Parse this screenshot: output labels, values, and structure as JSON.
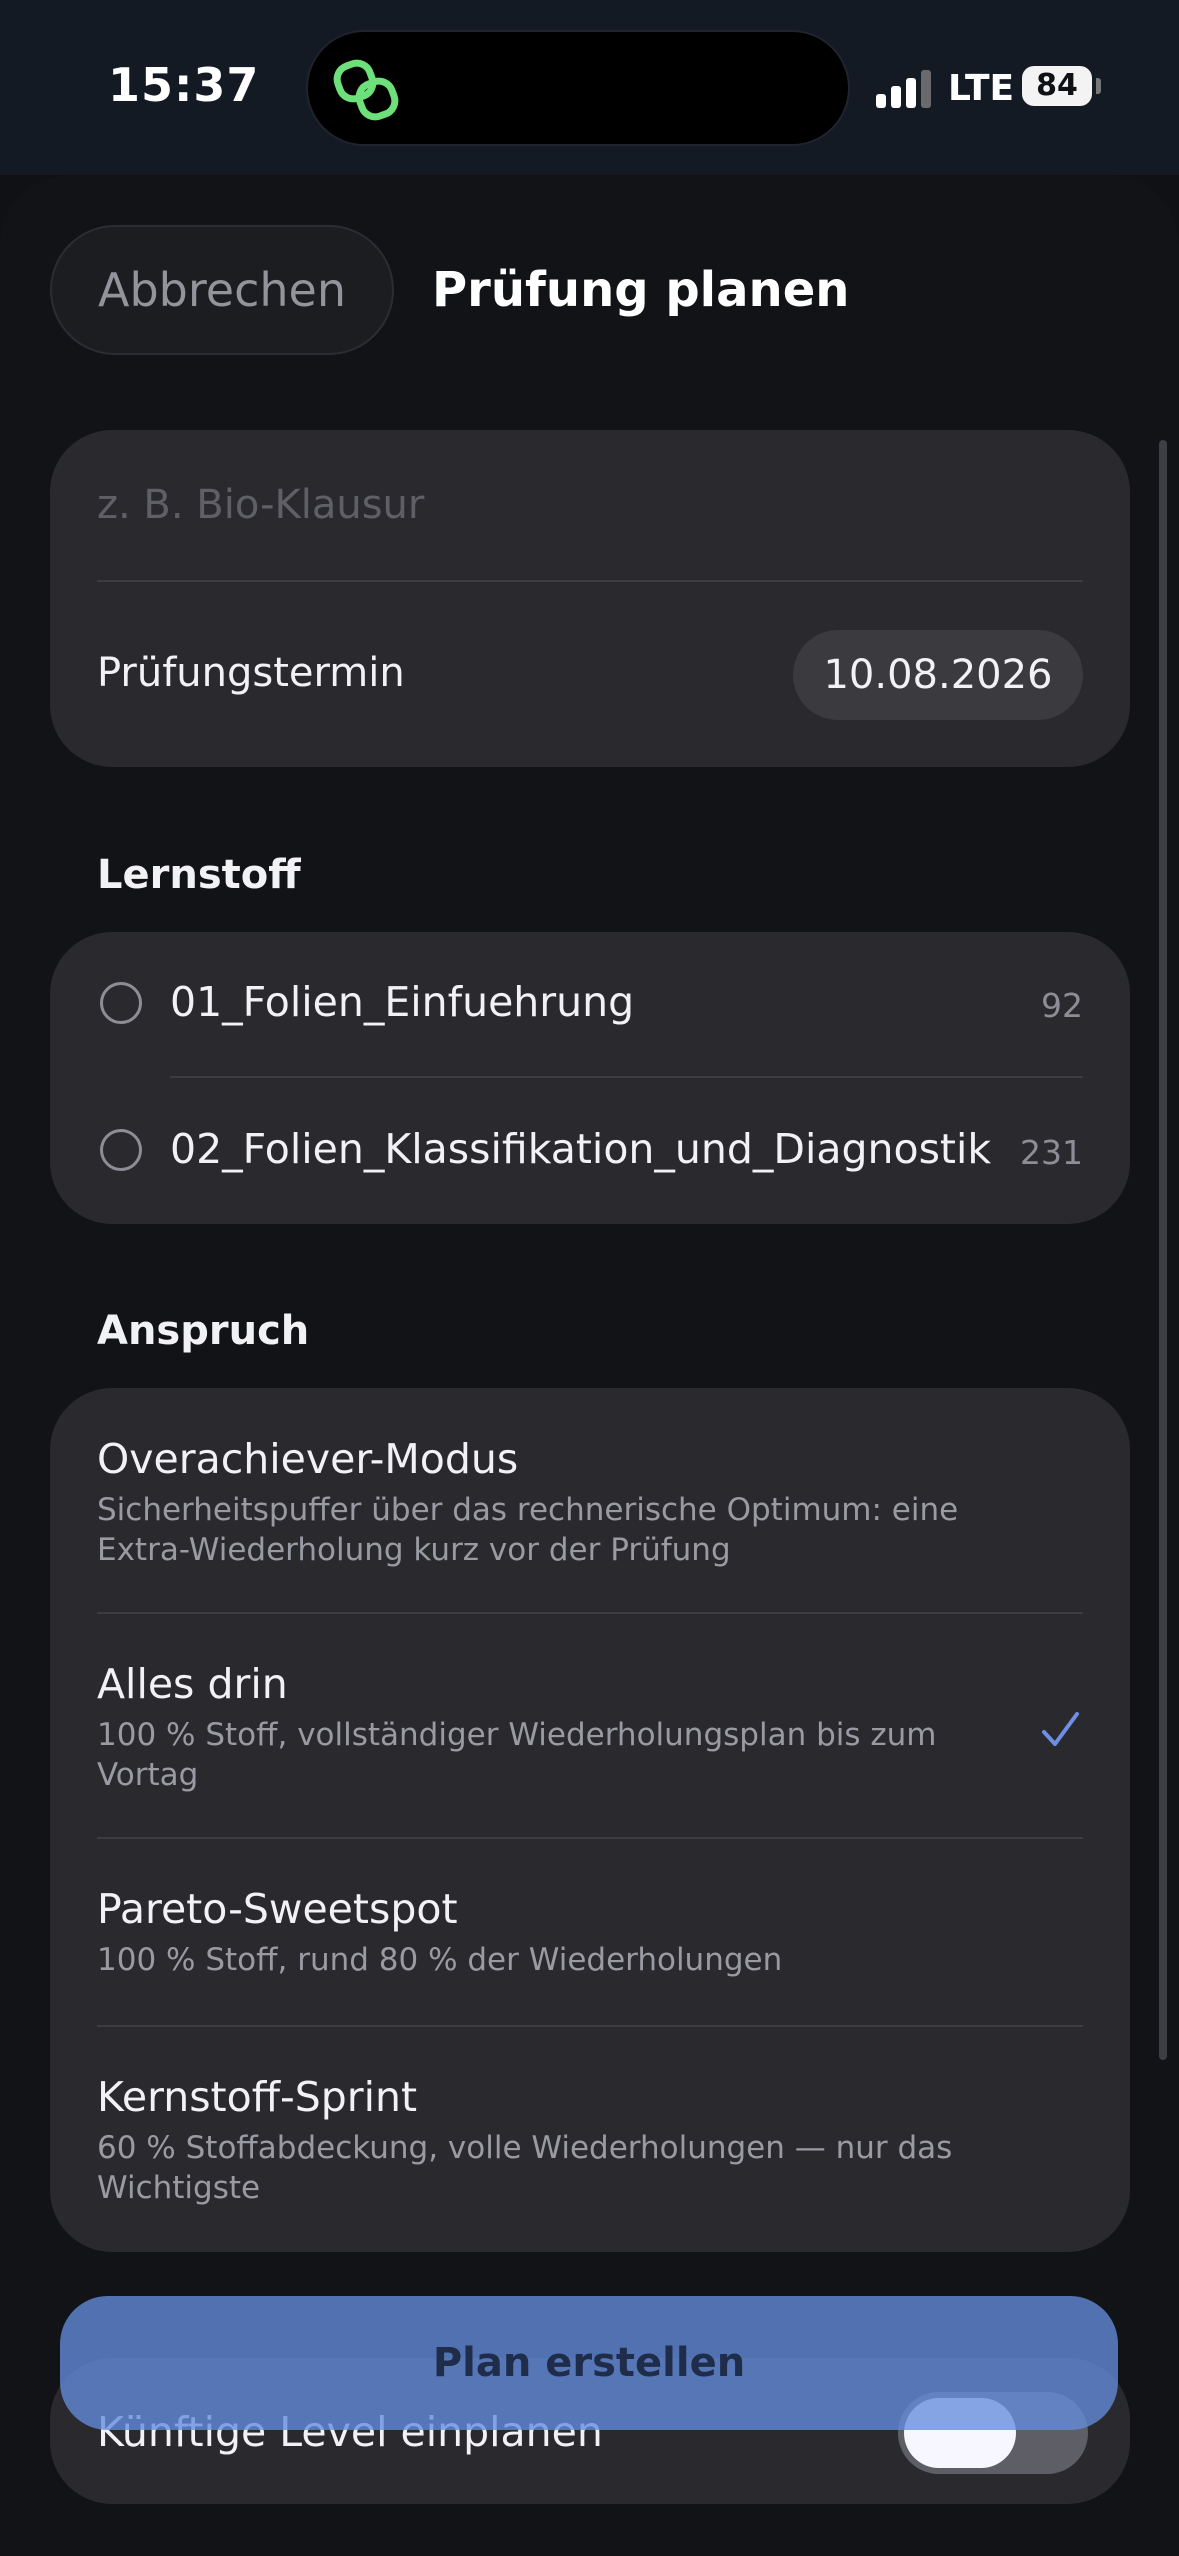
{
  "status_bar": {
    "time": "15:37",
    "network": "LTE",
    "battery": "84"
  },
  "header": {
    "cancel_label": "Abbrechen",
    "title": "Prüfung planen"
  },
  "exam_form": {
    "name_placeholder": "z. B. Bio-Klausur",
    "date_label": "Prüfungstermin",
    "date_value": "10.08.2026"
  },
  "study_material": {
    "heading": "Lernstoff",
    "files": [
      {
        "name": "01_Folien_Einfuehrung",
        "count": "92"
      },
      {
        "name": "02_Folien_Klassifikation_und_Diagnostik",
        "count": "231"
      }
    ]
  },
  "ambition": {
    "heading": "Anspruch",
    "options": [
      {
        "title": "Overachiever-Modus",
        "description": "Sicherheitspuffer über das rechnerische Optimum: eine Extra-Wiederholung kurz vor der Prüfung",
        "selected": false
      },
      {
        "title": "Alles drin",
        "description": "100 % Stoff, vollständiger Wiederholungsplan bis zum Vortag",
        "selected": true
      },
      {
        "title": "Pareto-Sweetspot",
        "description": "100 % Stoff, rund 80 % der Wiederholungen",
        "selected": false
      },
      {
        "title": "Kernstoff-Sprint",
        "description": "60 % Stoffabdeckung, volle Wiederholungen — nur das Wichtigste",
        "selected": false
      }
    ]
  },
  "future_levels": {
    "label": "Künftige Level einplanen",
    "enabled": true
  },
  "primary_action": {
    "label": "Plan erstellen"
  },
  "colors": {
    "accent": "#7b9cf0",
    "check": "#6f8fe6",
    "card": "#2a2a2e",
    "background": "#121316"
  }
}
